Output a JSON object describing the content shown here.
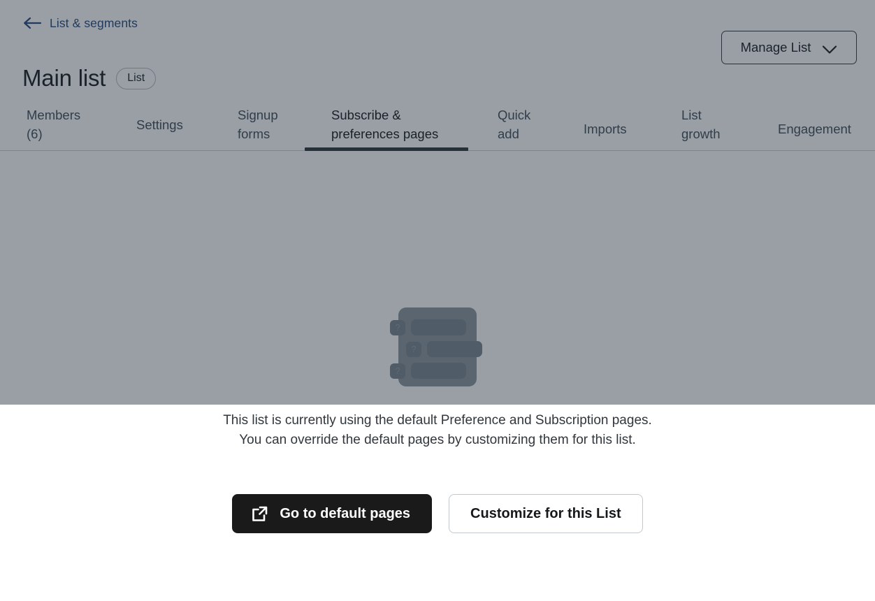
{
  "breadcrumb": {
    "label": "List & segments",
    "icon": "arrow-left-icon"
  },
  "header": {
    "title": "Main list",
    "badge": "List",
    "manage_button": {
      "label": "Manage List",
      "icon": "chevron-down-icon"
    }
  },
  "tabs": [
    {
      "label": "Members (6)",
      "active": false
    },
    {
      "label": "Settings",
      "active": false
    },
    {
      "label": "Signup forms",
      "active": false
    },
    {
      "label": "Subscribe & preferences pages",
      "active": true
    },
    {
      "label": "Quick add",
      "active": false
    },
    {
      "label": "Imports",
      "active": false
    },
    {
      "label": "List growth",
      "active": false
    },
    {
      "label": "Engagement",
      "active": false
    }
  ],
  "empty_state": {
    "illustration": {
      "name": "preferences-form-illustration",
      "rows": [
        {
          "badge": "?"
        },
        {
          "badge": "?"
        },
        {
          "badge": "?"
        }
      ]
    },
    "message": "This list is currently using the default Preference and Subscription pages. You can override the default pages by customizing them for this list.",
    "primary_button": {
      "label": "Go to default pages",
      "icon": "external-link-icon"
    },
    "secondary_button": {
      "label": "Customize for this List"
    }
  },
  "colors": {
    "scrim": "#868f98",
    "link": "#22457c",
    "primary_button_bg": "#1a1a1a",
    "active_tab_underline": "#2b3338"
  }
}
